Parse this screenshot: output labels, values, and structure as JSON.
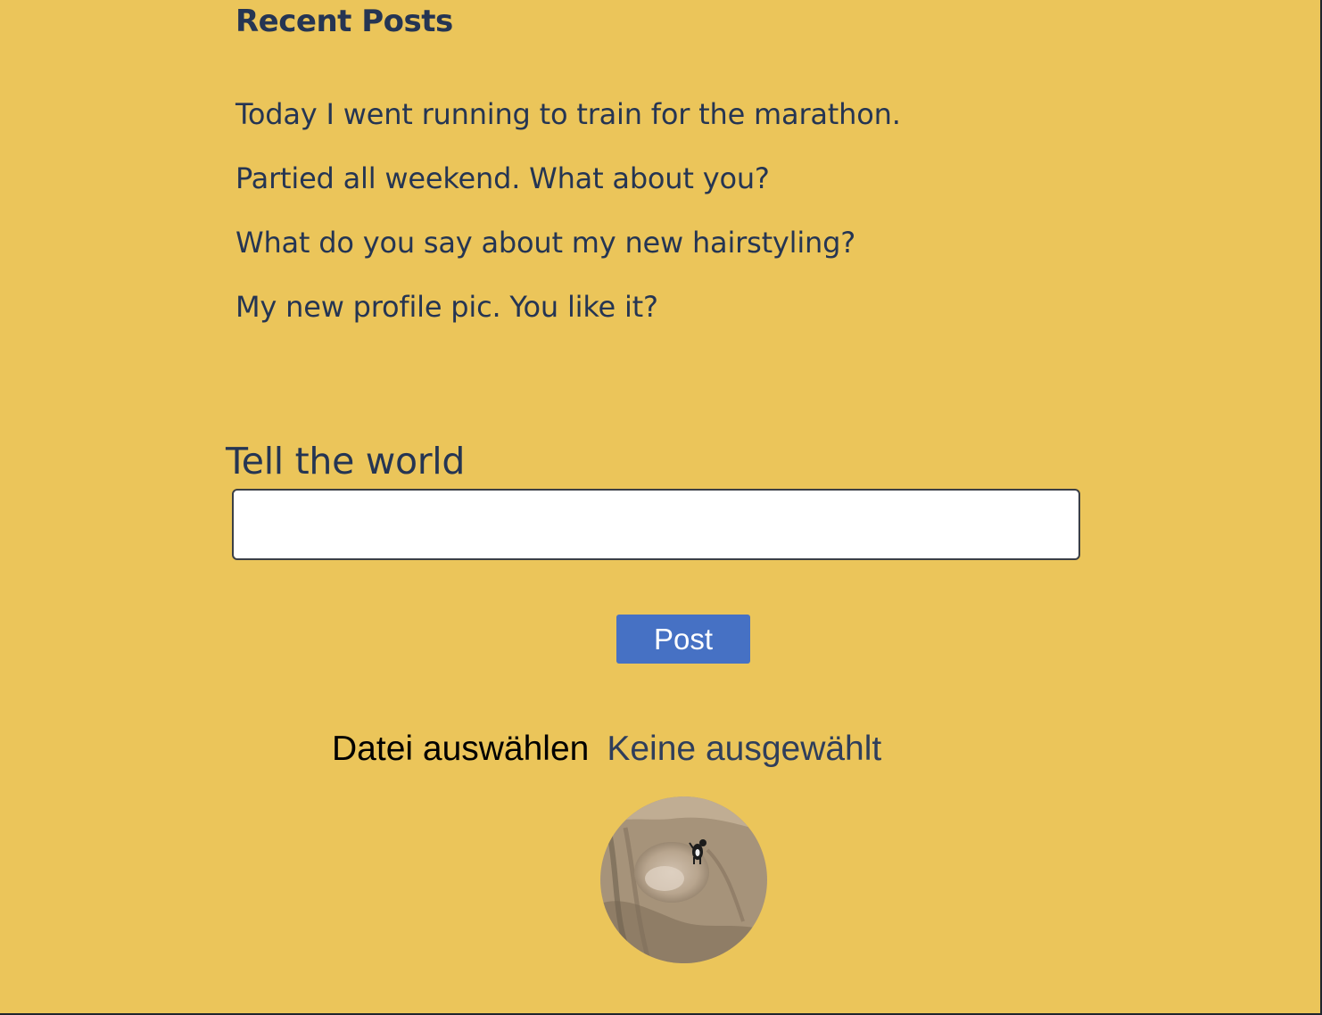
{
  "recent_posts": {
    "title": "Recent Posts",
    "items": [
      "Today I went running to train for the marathon.",
      "Partied all weekend. What about you?",
      "What do you say about my new hairstyling?",
      "My new profile pic. You like it?"
    ]
  },
  "compose": {
    "label": "Tell the world",
    "value": "",
    "post_button_label": "Post"
  },
  "file_upload": {
    "button_label": "Datei auswählen",
    "status": "Keine ausgewählt"
  },
  "colors": {
    "background": "#ebc55a",
    "text": "#253553",
    "button": "#4671c4"
  }
}
